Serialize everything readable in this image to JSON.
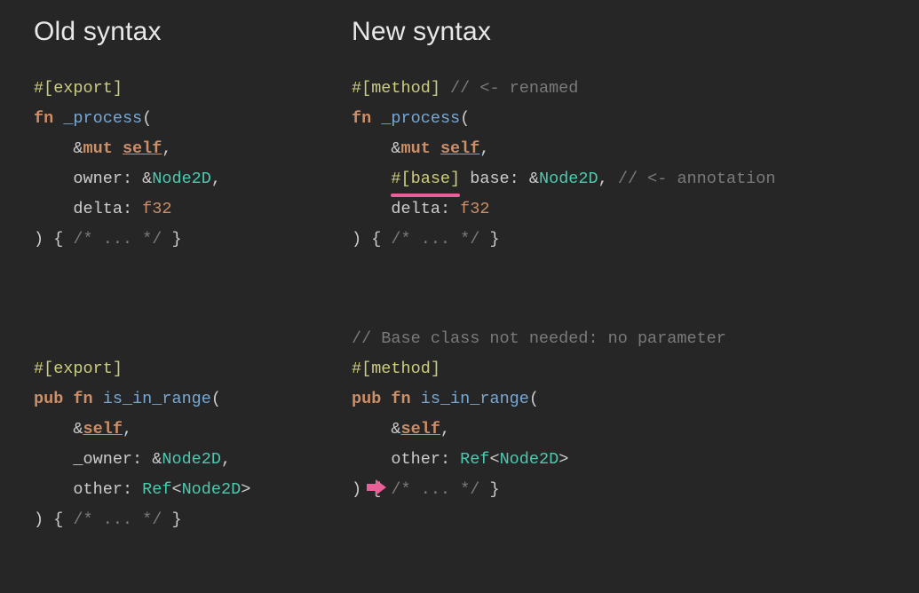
{
  "headings": {
    "old": "Old syntax",
    "new": "New syntax"
  },
  "code": {
    "old1": {
      "attr": "#[export]",
      "fn": "fn",
      "name": "_process",
      "l1_open": "(",
      "p1_amp": "&",
      "p1_mut": "mut",
      "p1_self": "self",
      "p1_comma": ",",
      "p2_name": "owner",
      "p2_colon": ":",
      "p2_amp": "&",
      "p2_type": "Node2D",
      "p2_comma": ",",
      "p3_name": "delta",
      "p3_colon": ":",
      "p3_type": "f32",
      "close": ") {",
      "body_comment": "/* ... */",
      "close_brace": "}"
    },
    "old2": {
      "attr": "#[export]",
      "pub": "pub",
      "fn": "fn",
      "name": "is_in_range",
      "l1_open": "(",
      "p1_amp": "&",
      "p1_self": "self",
      "p1_comma": ",",
      "p2_name": "_owner",
      "p2_colon": ":",
      "p2_amp": "&",
      "p2_type": "Node2D",
      "p2_comma": ",",
      "p3_name": "other",
      "p3_colon": ":",
      "p3_ref": "Ref",
      "p3_lt": "<",
      "p3_type": "Node2D",
      "p3_gt": ">",
      "close": ") {",
      "body_comment": "/* ... */",
      "close_brace": "}"
    },
    "new1": {
      "attr": "#[method]",
      "attr_comment": "// <- renamed",
      "fn": "fn",
      "name": "_process",
      "l1_open": "(",
      "p1_amp": "&",
      "p1_mut": "mut",
      "p1_self": "self",
      "p1_comma": ",",
      "p2_baseattr": "#[base]",
      "p2_name": "base",
      "p2_colon": ":",
      "p2_amp": "&",
      "p2_type": "Node2D",
      "p2_comma": ",",
      "p2_comment": "// <- annotation",
      "p3_name": "delta",
      "p3_colon": ":",
      "p3_type": "f32",
      "close": ") {",
      "body_comment": "/* ... */",
      "close_brace": "}"
    },
    "new2": {
      "pre_comment": "// Base class not needed: no parameter",
      "attr": "#[method]",
      "pub": "pub",
      "fn": "fn",
      "name": "is_in_range",
      "l1_open": "(",
      "p1_amp": "&",
      "p1_self": "self",
      "p1_comma": ",",
      "p2_name": "other",
      "p2_colon": ":",
      "p2_ref": "Ref",
      "p2_lt": "<",
      "p2_type": "Node2D",
      "p2_gt": ">",
      "close": ") {",
      "body_comment": "/* ... */",
      "close_brace": "}"
    }
  }
}
